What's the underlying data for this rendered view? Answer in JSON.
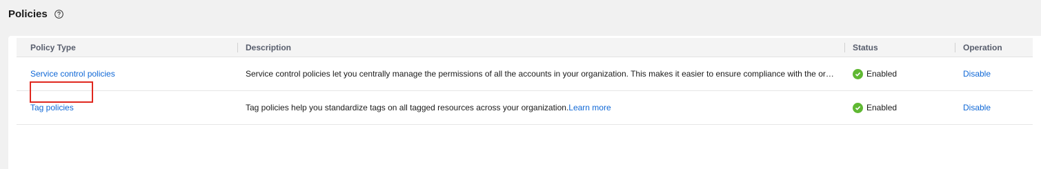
{
  "header": {
    "title": "Policies",
    "help_icon": "question-circle-icon"
  },
  "table": {
    "columns": [
      "Policy Type",
      "Description",
      "Status",
      "Operation"
    ],
    "rows": [
      {
        "policy_type": "Service control policies",
        "description": "Service control policies let you centrally manage the permissions of all the accounts in your organization. This makes it easier to ensure compliance with the organization's security policies.",
        "description_link": "",
        "status": "Enabled",
        "operation": "Disable"
      },
      {
        "policy_type": "Tag policies",
        "description": "Tag policies help you standardize tags on all tagged resources across your organization.",
        "description_link": "Learn more",
        "status": "Enabled",
        "operation": "Disable"
      }
    ]
  },
  "colors": {
    "link": "#0e67d6",
    "status_ok": "#5fb832",
    "highlight": "#e0271e"
  }
}
